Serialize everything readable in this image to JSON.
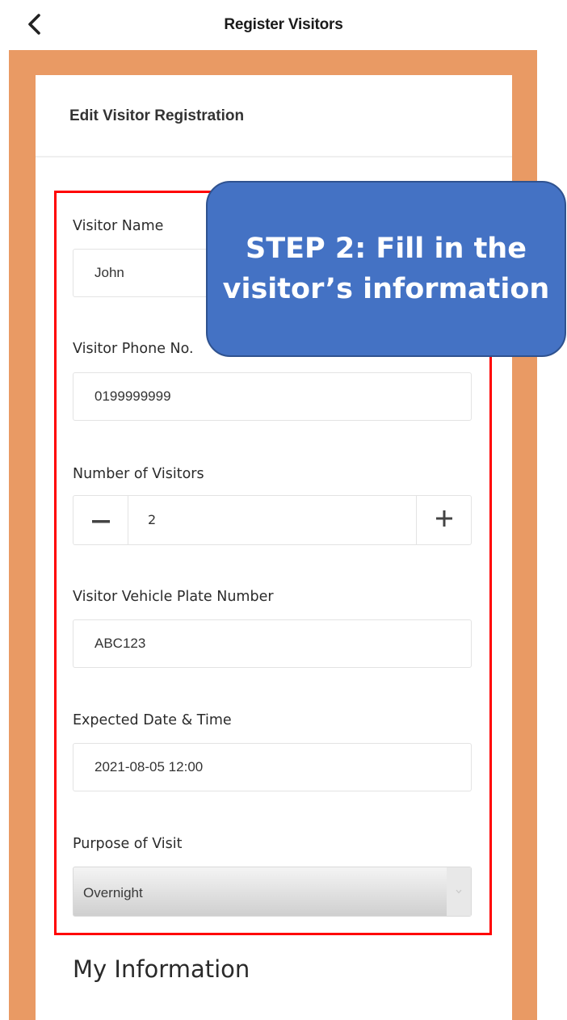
{
  "header": {
    "title": "Register Visitors",
    "back_icon": "chevron-left-icon"
  },
  "card": {
    "title": "Edit Visitor Registration"
  },
  "form": {
    "visitor_name": {
      "label": "Visitor Name",
      "value": "John"
    },
    "visitor_phone": {
      "label": "Visitor Phone No.",
      "value": "0199999999"
    },
    "number_of_visitors": {
      "label": "Number of Visitors",
      "value": "2",
      "minus_icon": "minus-icon",
      "plus_icon": "plus-icon"
    },
    "vehicle_plate": {
      "label": "Visitor Vehicle Plate Number",
      "value": "ABC123"
    },
    "expected_datetime": {
      "label": "Expected Date & Time",
      "value": "2021-08-05 12:00"
    },
    "purpose": {
      "label": "Purpose of Visit",
      "value": "Overnight"
    }
  },
  "my_information": {
    "title": "My Information"
  },
  "annotation": {
    "callout_text": "STEP 2: Fill in the visitor’s information",
    "callout_color": "#4472c4",
    "frame_color": "#ff0000"
  },
  "colors": {
    "brand_orange": "#e99a64"
  }
}
